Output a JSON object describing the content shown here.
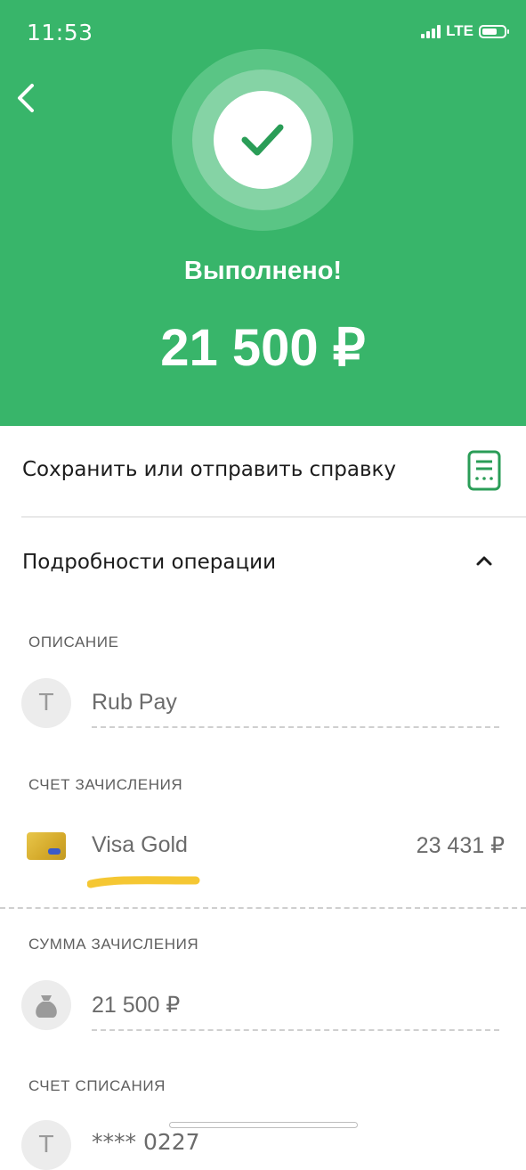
{
  "status_bar": {
    "time": "11:53",
    "network": "LTE"
  },
  "hero": {
    "title": "Выполнено!",
    "amount": "21 500 ₽"
  },
  "actions": {
    "receipt_label": "Сохранить или отправить справку",
    "details_label": "Подробности операции"
  },
  "details": {
    "description": {
      "title": "ОПИСАНИЕ",
      "icon_letter": "Т",
      "value": "Rub Pay"
    },
    "credit_account": {
      "title": "СЧЕТ ЗАЧИСЛЕНИЯ",
      "value": "Visa Gold",
      "balance": "23 431 ₽"
    },
    "credit_amount": {
      "title": "СУММА ЗАЧИСЛЕНИЯ",
      "value": "21 500 ₽"
    },
    "debit_account": {
      "title": "СЧЕТ СПИСАНИЯ",
      "icon_letter": "Т",
      "value": "**** 0227"
    }
  },
  "colors": {
    "accent": "#38b56a",
    "accent_light": "#85d3a5"
  },
  "icons": [
    "back-icon",
    "check-icon",
    "document-icon",
    "chevron-up-icon",
    "bag-icon",
    "card-icon"
  ]
}
